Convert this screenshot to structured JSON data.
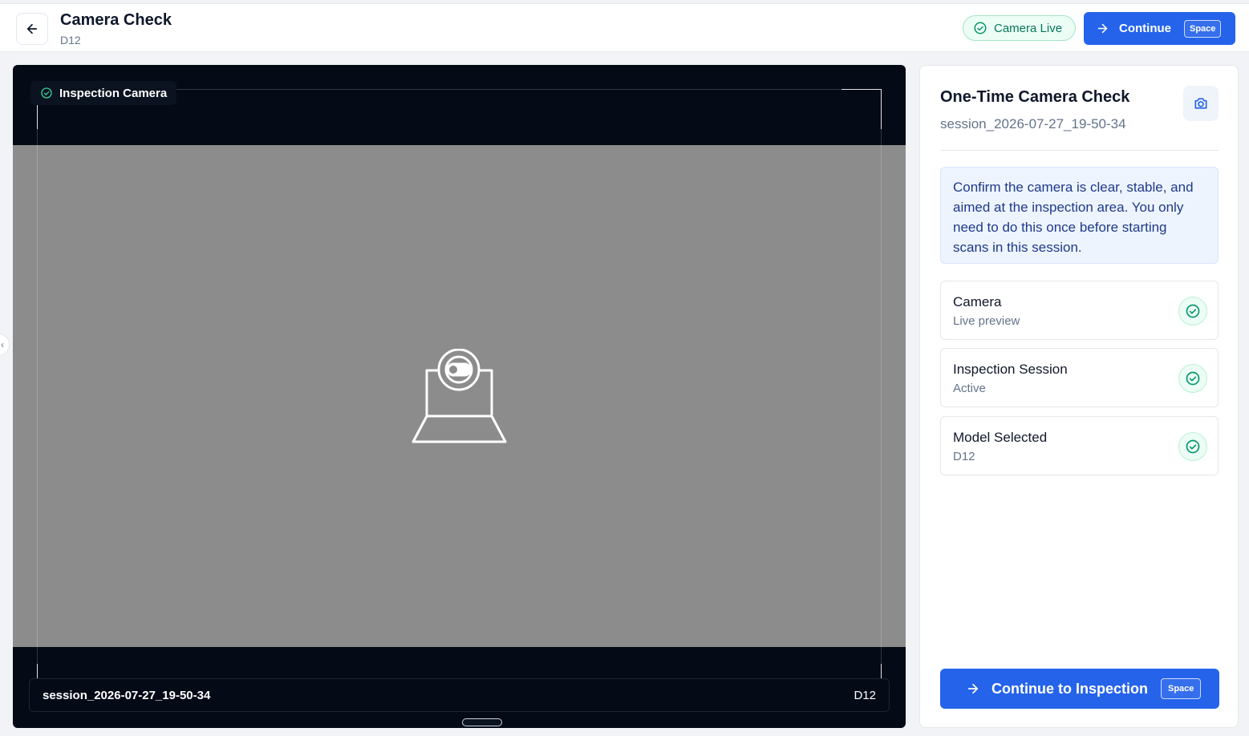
{
  "header": {
    "title": "Camera Check",
    "subtitle": "D12",
    "status_badge": "Camera Live",
    "continue_label": "Continue",
    "continue_shortcut": "Space"
  },
  "camera": {
    "label": "Inspection Camera",
    "session": "session_2026-07-27_19-50-34",
    "model": "D12"
  },
  "panel": {
    "title": "One-Time Camera Check",
    "session": "session_2026-07-27_19-50-34",
    "info": "Confirm the camera is clear, stable, and aimed at the inspection area. You only need to do this once before starting scans in this session.",
    "checks": [
      {
        "name": "Camera",
        "value": "Live preview"
      },
      {
        "name": "Inspection Session",
        "value": "Active"
      },
      {
        "name": "Model Selected",
        "value": "D12"
      }
    ],
    "primary_label": "Continue to Inspection",
    "primary_shortcut": "Space"
  },
  "colors": {
    "accent": "#2563eb",
    "success": "#10b981",
    "camera_bg": "#050a17",
    "preview_bg": "#8c8c8c"
  },
  "icons": {
    "back": "arrow-left-icon",
    "status": "check-circle-icon",
    "continue": "arrow-right-icon",
    "snapshot": "camera-icon",
    "placeholder": "webcam-icon"
  }
}
